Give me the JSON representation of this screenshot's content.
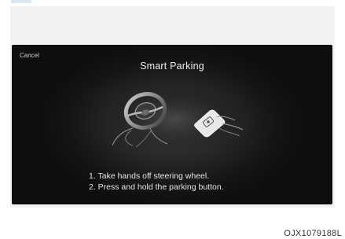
{
  "screen": {
    "cancel_label": "Cancel",
    "title": "Smart Parking",
    "instructions": [
      "1. Take hands off steering wheel.",
      "2. Press and hold the parking button."
    ],
    "icons": [
      "steering-wheel-icon",
      "parking-button-icon"
    ]
  },
  "figure": {
    "code": "OJX1079188L"
  },
  "colors": {
    "screen_bg": "#141414",
    "text": "#e6e6e6",
    "figure_bg": "#f2f2f2"
  }
}
